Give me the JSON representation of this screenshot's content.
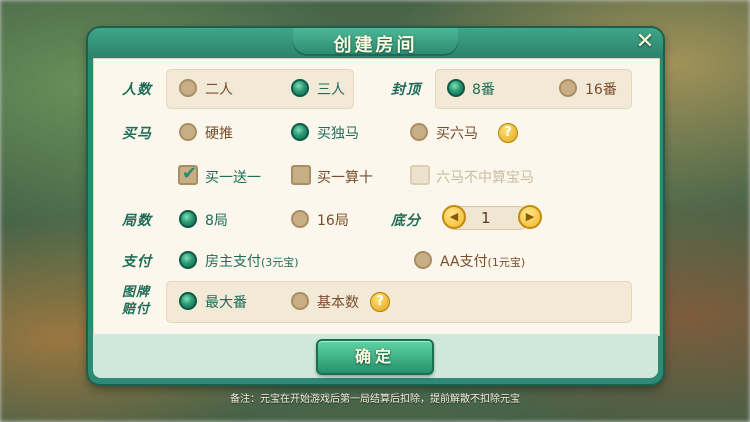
{
  "dialog": {
    "title": "创建房间",
    "close": "✕"
  },
  "players": {
    "label": "人数",
    "options": [
      "二人",
      "三人"
    ],
    "selected": 1
  },
  "cap": {
    "label": "封顶",
    "options": [
      "8番",
      "16番"
    ],
    "selected": 0
  },
  "horse": {
    "label": "买马",
    "options": [
      "硬推",
      "买独马",
      "买六马"
    ],
    "selected": 1,
    "help": "?"
  },
  "extras": {
    "options": [
      "买一送一",
      "买一算十",
      "六马不中算宝马"
    ],
    "checked": [
      true,
      false,
      false
    ],
    "disabled": [
      false,
      false,
      true
    ]
  },
  "rounds": {
    "label": "局数",
    "options": [
      "8局",
      "16局"
    ],
    "selected": 0
  },
  "base": {
    "label": "底分",
    "value": "1"
  },
  "payment": {
    "label": "支付",
    "options": [
      {
        "text": "房主支付",
        "note": "(3元宝)"
      },
      {
        "text": "AA支付",
        "note": "(1元宝)"
      }
    ],
    "selected": 0
  },
  "payout": {
    "label_line1": "图牌",
    "label_line2": "赔付",
    "options": [
      "最大番",
      "基本数"
    ],
    "selected": 0,
    "help": "?"
  },
  "confirm_label": "确定",
  "note": "备注：元宝在开始游戏后第一局结算后扣除，提前解散不扣除元宝"
}
